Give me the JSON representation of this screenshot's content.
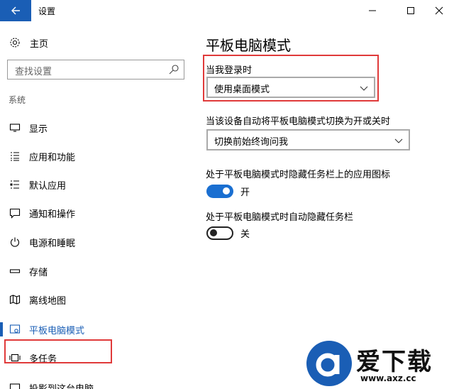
{
  "window": {
    "title": "设置"
  },
  "sidebar": {
    "home_label": "主页",
    "search_placeholder": "查找设置",
    "section_label": "系统",
    "items": [
      {
        "label": "显示",
        "icon": "display-icon"
      },
      {
        "label": "应用和功能",
        "icon": "apps-list-icon"
      },
      {
        "label": "默认应用",
        "icon": "default-apps-icon"
      },
      {
        "label": "通知和操作",
        "icon": "notification-icon"
      },
      {
        "label": "电源和睡眠",
        "icon": "power-icon"
      },
      {
        "label": "存储",
        "icon": "storage-icon"
      },
      {
        "label": "离线地图",
        "icon": "map-icon"
      },
      {
        "label": "平板电脑模式",
        "icon": "tablet-mode-icon",
        "active": true
      },
      {
        "label": "多任务",
        "icon": "multitask-icon"
      },
      {
        "label": "投影到这台电脑",
        "icon": "project-icon"
      }
    ]
  },
  "main": {
    "title": "平板电脑模式",
    "signin_label": "当我登录时",
    "signin_value": "使用桌面模式",
    "auto_switch_label": "当该设备自动将平板电脑模式切换为开或关时",
    "auto_switch_value": "切换前始终询问我",
    "hide_icons_label": "处于平板电脑模式时隐藏任务栏上的应用图标",
    "hide_icons_state": "开",
    "auto_hide_label": "处于平板电脑模式时自动隐藏任务栏",
    "auto_hide_state": "关"
  },
  "watermark": {
    "text": "爱下载",
    "url": "www.axz.cc"
  },
  "colors": {
    "accent": "#1a5eb5",
    "toggle_on": "#1a6fd1",
    "highlight": "#e03a3a"
  }
}
